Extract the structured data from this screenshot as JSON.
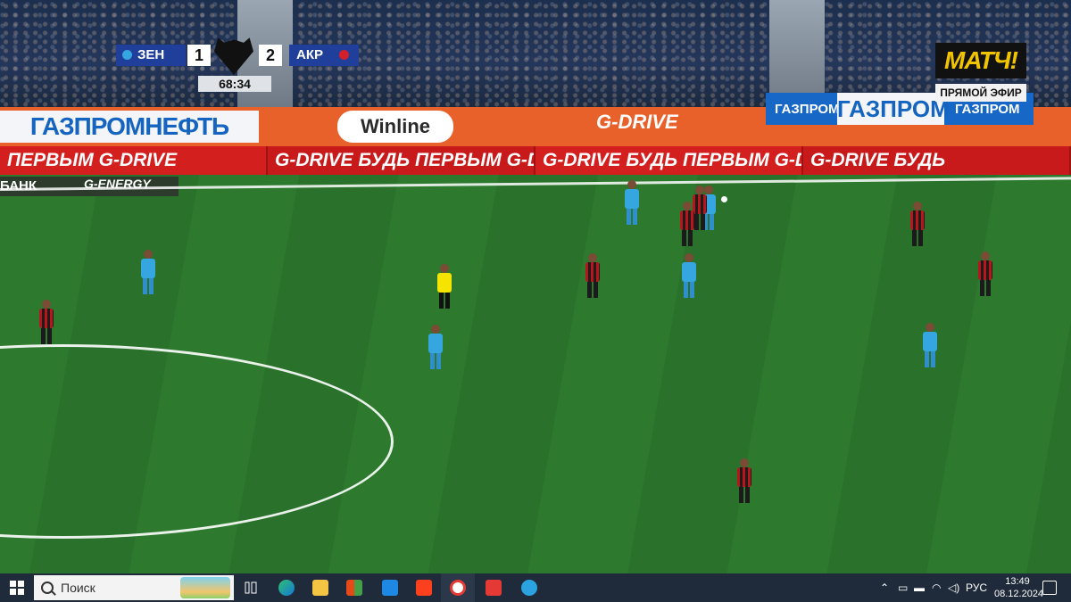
{
  "broadcast": {
    "scoreboard": {
      "home_team": "ЗЕН",
      "home_score": "1",
      "away_team": "АКР",
      "away_score": "2",
      "clock": "68:34",
      "home_color": "#36a6e0",
      "away_color": "#d3202a"
    },
    "channel": {
      "logo_text": "МАТЧ!",
      "live_label": "ПРЯМОЙ ЭФИР"
    },
    "boards": {
      "gazprom_neft": "ГАЗПРОМНЕФТЬ",
      "winline": "Winline",
      "gdrive_top": "G-DRIVE",
      "gazprom_small": "ГАЗПРОМ",
      "gazprom_big": "ГАЗПРОМ",
      "gazprom_small_right": "ГАЗПРОМ",
      "led": [
        "ПЕРВЫМ  G-DRIVE",
        "G-DRIVE  БУДЬ ПЕРВЫМ  G-DRIVE",
        "G-DRIVE  БУДЬ ПЕРВЫМ  G-DRIVE",
        "G-DRIVE  БУДЬ"
      ],
      "bank": "БАНК",
      "energy": "G-ENERGY"
    }
  },
  "taskbar": {
    "search_placeholder": "Поиск",
    "apps": [
      "start-icon",
      "task-view-icon",
      "edge-icon",
      "file-explorer-icon",
      "store-icon",
      "mail-icon",
      "yandex-icon",
      "yandex-browser-icon",
      "wps-icon",
      "telegram-icon"
    ],
    "language": "РУС",
    "time": "13:49",
    "date": "08.12.2024"
  }
}
